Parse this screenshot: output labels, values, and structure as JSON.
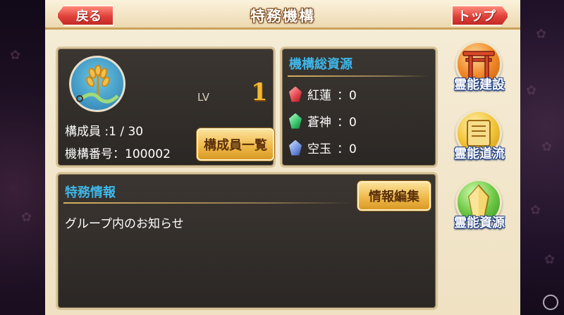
{
  "header": {
    "title": "特務機構",
    "back_label": "戻る",
    "top_label": "トップ"
  },
  "organization": {
    "lv_label": "LV",
    "lv_value": "1",
    "members_text": "構成員 :1 / 30",
    "number_text": "機構番号：100002",
    "members_button_label": "構成員一覧"
  },
  "resources": {
    "title": "機構総資源",
    "items": [
      {
        "name": "紅蓮",
        "value": "：0",
        "icon": "red-crystal-icon",
        "color": "#e2424a"
      },
      {
        "name": "蒼神",
        "value": "：0",
        "icon": "green-crystal-icon",
        "color": "#35c26a"
      },
      {
        "name": "空玉",
        "value": "：0",
        "icon": "blue-crystal-icon",
        "color": "#6f8fe0"
      }
    ]
  },
  "info": {
    "title": "特務情報",
    "edit_label": "情報編集",
    "text": "グループ内のお知らせ"
  },
  "side_menu": {
    "items": [
      {
        "label": "霊能建設",
        "icon": "torii-gate-icon"
      },
      {
        "label": "霊能道流",
        "icon": "scroll-icon"
      },
      {
        "label": "霊能資源",
        "icon": "crystal-icon"
      }
    ]
  },
  "colors": {
    "accent_blue": "#3fb6e8",
    "button_red": "#e0413a",
    "button_gold": "#f0b94a"
  }
}
